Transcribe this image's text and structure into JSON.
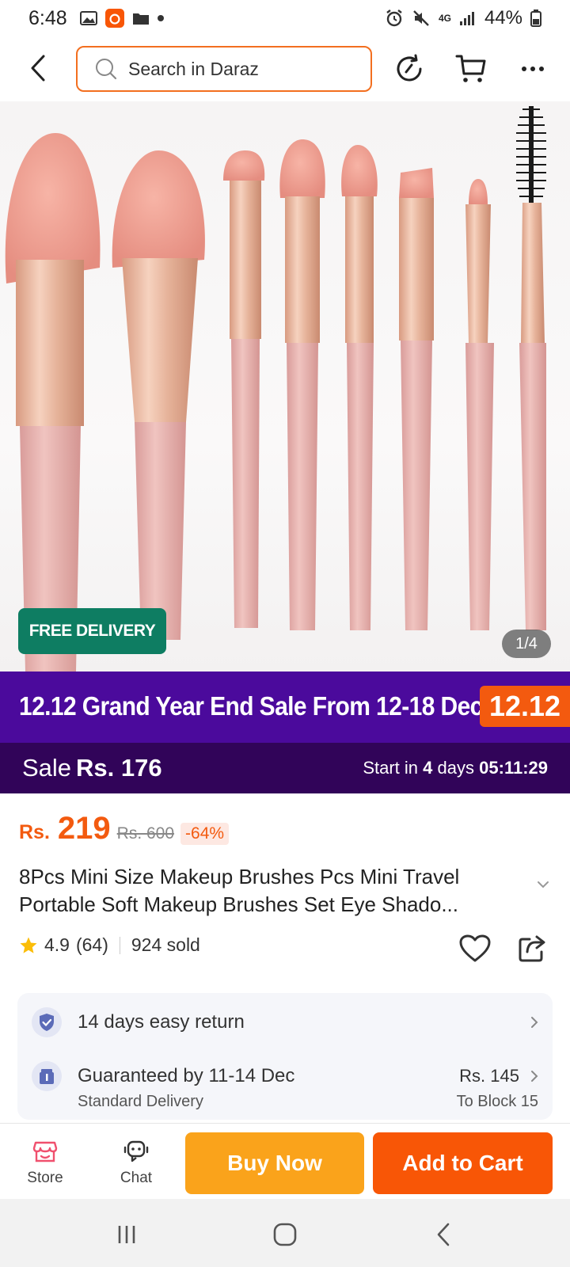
{
  "status_bar": {
    "time": "6:48",
    "network": "4G",
    "battery": "44%"
  },
  "search": {
    "placeholder": "Search in Daraz"
  },
  "gallery": {
    "badge": "FREE DELIVERY",
    "counter": "1/4"
  },
  "sale": {
    "banner_text": "12.12 Grand Year End Sale From 12-18 December",
    "banner_tag": "12.12",
    "label": "Sale",
    "price": "Rs. 176",
    "start_prefix": "Start in",
    "start_days": "4",
    "start_days_word": "days",
    "countdown": "05:11:29"
  },
  "product": {
    "currency": "Rs.",
    "price": "219",
    "original_price": "Rs. 600",
    "discount": "-64%",
    "title_line1": "8Pcs Mini Size Makeup Brushes Pcs Mini Travel",
    "title_line2": "Portable Soft Makeup Brushes Set Eye Shado...",
    "rating": "4.9",
    "reviews": "(64)",
    "sold": "924 sold"
  },
  "services": {
    "return_text": "14 days easy return",
    "delivery_text": "Guaranteed by 11-14 Dec",
    "delivery_price": "Rs. 145",
    "delivery_type": "Standard Delivery",
    "delivery_location": "To Block 15"
  },
  "actions": {
    "store": "Store",
    "chat": "Chat",
    "buy_now": "Buy Now",
    "add_to_cart": "Add to Cart"
  },
  "colors": {
    "brand_orange": "#f85606",
    "buy_now_yellow": "#faa31b",
    "sale_purple": "#4b0a9c",
    "free_delivery_green": "#0e7d62"
  }
}
